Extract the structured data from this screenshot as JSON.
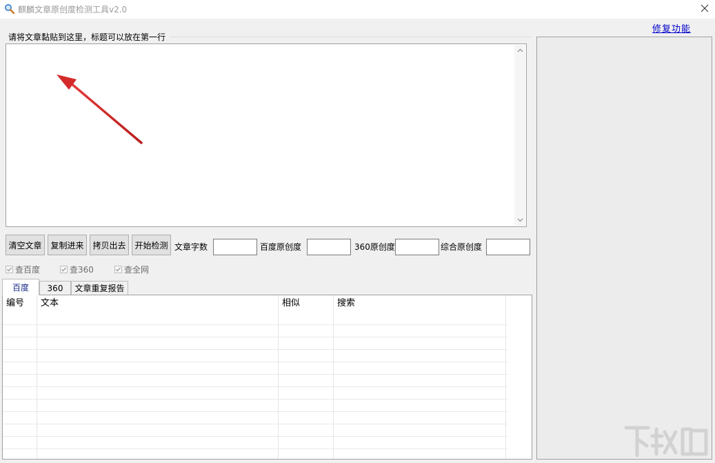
{
  "window": {
    "title": "麒麟文章原创度检测工具v2.0",
    "close_icon": "close-icon"
  },
  "editor": {
    "group_label": "请将文章黏贴到这里，标题可以放在第一行",
    "content": ""
  },
  "links": {
    "repair": "修复功能"
  },
  "toolbar": {
    "clear": "清空文章",
    "paste_in": "复制进来",
    "copy_out": "拷贝出去",
    "start": "开始检测",
    "word_count_label": "文章字数",
    "word_count_value": "",
    "baidu_label": "百度原创度",
    "baidu_value": "",
    "s360_label": "360原创度",
    "s360_value": "",
    "overall_label": "综合原创度",
    "overall_value": ""
  },
  "options": [
    {
      "label": "查百度",
      "checked": true
    },
    {
      "label": "查360",
      "checked": true
    },
    {
      "label": "查全网",
      "checked": true
    }
  ],
  "tabs": [
    "百度",
    "360",
    "文章重复报告"
  ],
  "active_tab": 0,
  "table": {
    "columns": [
      "编号",
      "文本",
      "相似",
      "搜索"
    ],
    "rows": []
  },
  "watermark": {
    "text": "下载吧"
  },
  "colors": {
    "link": "#0000cc",
    "arrow": "#d42a2a",
    "active_tab_text": "#1a2b8a"
  }
}
